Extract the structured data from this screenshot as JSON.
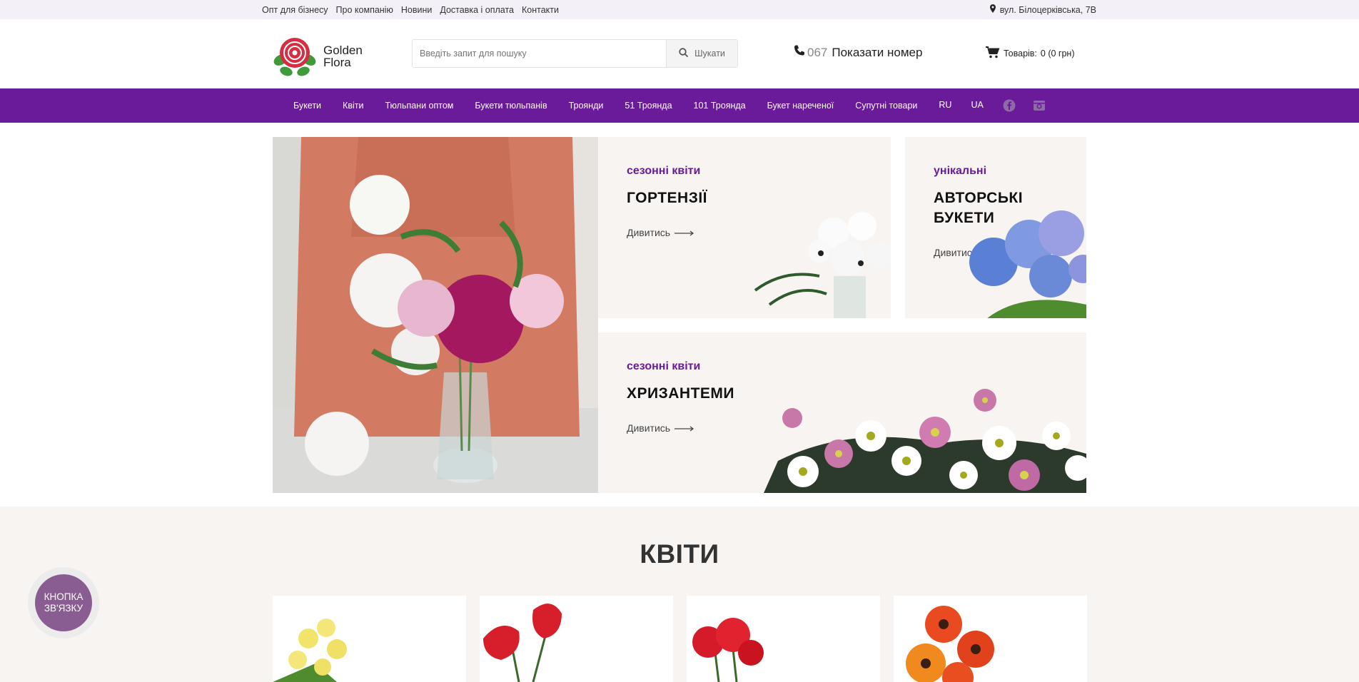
{
  "topbar": {
    "links": [
      "Опт для бізнесу",
      "Про компанію",
      "Новини",
      "Доставка і оплата",
      "Контакти"
    ],
    "address": "вул. Білоцерківська, 7В"
  },
  "header": {
    "logo_line1": "Golden",
    "logo_line2": "Flora",
    "search_placeholder": "Введіть запит для пошуку",
    "search_button": "Шукати",
    "phone_prefix": "067",
    "phone_label": "Показати номер",
    "cart_label": "Товарів:",
    "cart_value": "0 (0 грн)"
  },
  "nav": {
    "items": [
      "Букети",
      "Квіти",
      "Тюльпани оптом",
      "Букети тюльпанів",
      "Троянди",
      "51 Троянда",
      "101 Троянда",
      "Букет нареченої",
      "Супутні товари"
    ],
    "lang_ru": "RU",
    "lang_ua": "UA",
    "social": [
      "facebook-icon",
      "instagram-icon"
    ]
  },
  "banners": [
    {
      "kicker": "сезонні квіти",
      "title": "ГОРТЕНЗІЇ",
      "link": "Дивитись"
    },
    {
      "kicker": "унікальні",
      "title_line1": "АВТОРСЬКІ",
      "title_line2": "БУКЕТИ",
      "link": "Дивитись"
    },
    {
      "kicker": "сезонні квіти",
      "title": "ХРИЗАНТЕМИ",
      "link": "Дивитись"
    }
  ],
  "section": {
    "title": "КВІТИ"
  },
  "contact_button": {
    "line1": "КНОПКА",
    "line2": "ЗВ'ЯЗКУ"
  },
  "colors": {
    "brand_purple": "#6a1b9a",
    "card_bg": "#f8f4f1",
    "topbar_bg": "#f3f0f7",
    "fab": "#8a5d92"
  }
}
